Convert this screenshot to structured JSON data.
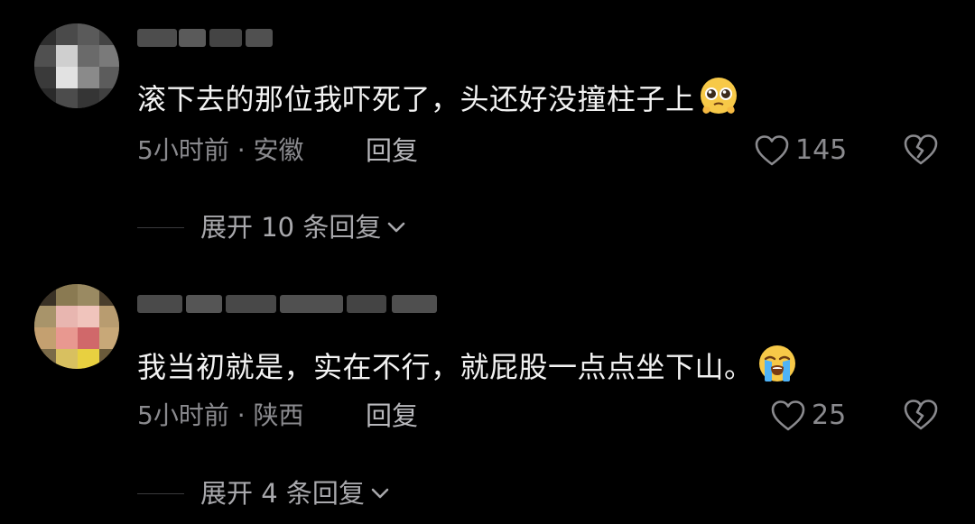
{
  "comments": [
    {
      "text": "滚下去的那位我吓死了，头还好没撞柱子上",
      "emoji_icon": "pleading-face-icon",
      "time_location": "5小时前 · 安徽",
      "reply_label": "回复",
      "like_count": "145",
      "expand_label": "展开 10 条回复"
    },
    {
      "text": "我当初就是，实在不行，就屁股一点点坐下山。",
      "emoji_icon": "loudly-crying-face-icon",
      "time_location": "5小时前 · 陕西",
      "reply_label": "回复",
      "like_count": "25",
      "expand_label": "展开 4 条回复"
    }
  ],
  "colors": {
    "background": "#000000",
    "text": "#f2f2f2",
    "secondary": "#8a8a8e",
    "reply": "#b8b8bc"
  }
}
